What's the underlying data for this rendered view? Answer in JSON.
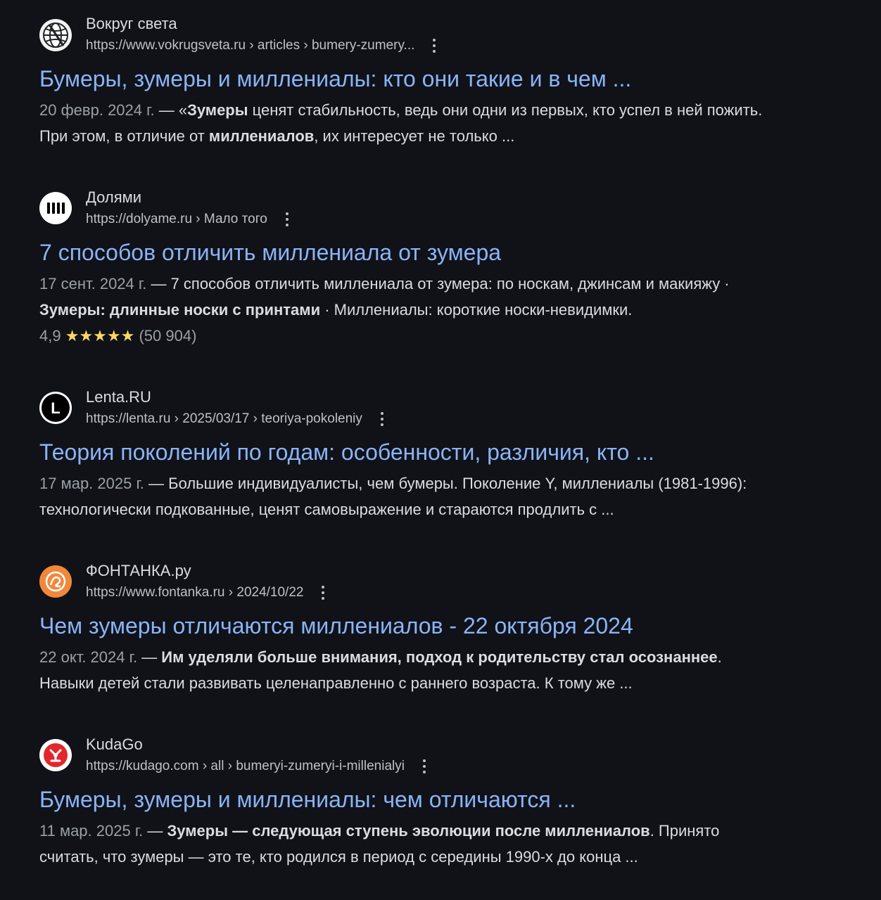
{
  "results": [
    {
      "site_name": "Вокруг света",
      "favicon": "globe-icon",
      "url": "https://www.vokrugsveta.ru › articles › bumery-zumery...",
      "title": "Бумеры, зумеры и миллениалы: кто они такие и в чем ...",
      "snippet": {
        "date": "20 февр. 2024 г.",
        "sep": " — ",
        "line1_parts": [
          {
            "text": "«",
            "bold": false
          },
          {
            "text": "Зумеры",
            "bold": true
          },
          {
            "text": " ценят стабильность, ведь они одни из первых, кто успел в ней пожить.",
            "bold": false
          }
        ],
        "line2_parts": [
          {
            "text": "При этом, в отличие от ",
            "bold": false
          },
          {
            "text": "миллениалов",
            "bold": true
          },
          {
            "text": ", их интересует не только ...",
            "bold": false
          }
        ]
      }
    },
    {
      "site_name": "Долями",
      "favicon": "dolyame-logo-icon",
      "url": "https://dolyame.ru › Мало того",
      "title": "7 способов отличить миллениала от зумера",
      "snippet": {
        "date": "17 сент. 2024 г.",
        "sep": " — ",
        "line1_parts": [
          {
            "text": "7 способов отличить миллениала от зумера: по носкам, джинсам и макияжу ·",
            "bold": false
          }
        ],
        "line2_parts": [
          {
            "text": "Зумеры: длинные носки с принтами",
            "bold": true
          },
          {
            "text": " · Миллениалы: короткие носки-невидимки.",
            "bold": false
          }
        ]
      },
      "rating": {
        "value": "4,9",
        "stars": "★★★★★",
        "count": "(50 904)"
      }
    },
    {
      "site_name": "Lenta.RU",
      "favicon": "lenta-logo-icon",
      "favicon_letter": "L",
      "url": "https://lenta.ru › 2025/03/17 › teoriya-pokoleniy",
      "title": "Теория поколений по годам: особенности, различия, кто ...",
      "snippet": {
        "date": "17 мар. 2025 г.",
        "sep": " — ",
        "line1_parts": [
          {
            "text": "Большие индивидуалисты, чем бумеры. Поколение Y, миллениалы (1981-1996):",
            "bold": false
          }
        ],
        "line2_parts": [
          {
            "text": "технологически подкованные, ценят самовыражение и стараются продлить с ...",
            "bold": false
          }
        ]
      }
    },
    {
      "site_name": "ФОНТАНКА.ру",
      "favicon": "fontanka-logo-icon",
      "url": "https://www.fontanka.ru › 2024/10/22",
      "title": "Чем зумеры отличаются миллениалов - 22 октября 2024",
      "snippet": {
        "date": "22 окт. 2024 г.",
        "sep": " — ",
        "line1_parts": [
          {
            "text": "Им уделяли больше внимания, подход к родительству стал осознаннее",
            "bold": true
          },
          {
            "text": ".",
            "bold": false
          }
        ],
        "line2_parts": [
          {
            "text": "Навыки детей стали развивать целенаправленно с раннего возраста. К тому же ...",
            "bold": false
          }
        ]
      }
    },
    {
      "site_name": "KudaGo",
      "favicon": "kudago-logo-icon",
      "url": "https://kudago.com › all › bumeryi-zumeryi-i-millenialyi",
      "title": "Бумеры, зумеры и миллениалы: чем отличаются ...",
      "snippet": {
        "date": "11 мар. 2025 г.",
        "sep": " — ",
        "line1_parts": [
          {
            "text": "Зумеры — следующая ступень эволюции после миллениалов",
            "bold": true
          },
          {
            "text": ". Принято",
            "bold": false
          }
        ],
        "line2_parts": [
          {
            "text": "считать, что зумеры — это те, кто родился в период с середины 1990-х до конца ...",
            "bold": false
          }
        ]
      }
    }
  ],
  "colors": {
    "background": "#101218",
    "link": "#8ab4f8",
    "text": "#dadce0",
    "muted": "#9aa0a6",
    "stars": "#fdd663"
  }
}
